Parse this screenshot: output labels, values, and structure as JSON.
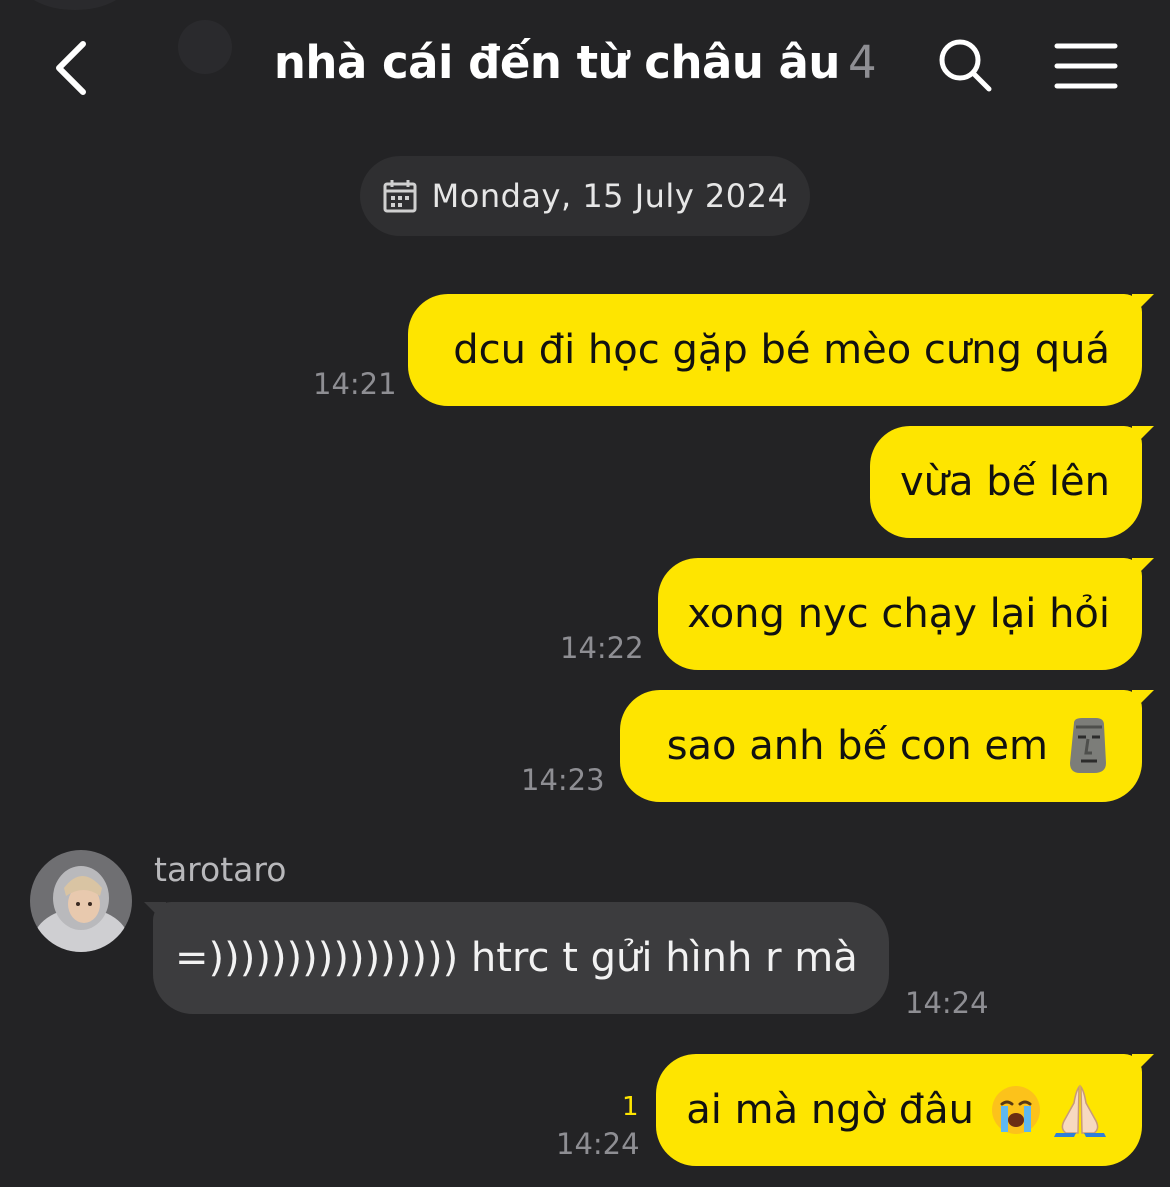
{
  "header": {
    "title": "nhà cái đến từ châu âu",
    "member_count": "4"
  },
  "date_separator": {
    "label": "Monday, 15 July 2024"
  },
  "messages": [
    {
      "direction": "out",
      "text": "dcu đi học gặp bé mèo cưng quá",
      "time": "14:21"
    },
    {
      "direction": "out",
      "text": "vừa bế lên",
      "time": ""
    },
    {
      "direction": "out",
      "text": "xong nyc chạy lại hỏi",
      "time": "14:22"
    },
    {
      "direction": "out",
      "text": "sao anh bế con em",
      "emoji": "moai-emoji",
      "time": "14:23"
    },
    {
      "direction": "in",
      "sender": "tarotaro",
      "text": "=)))))))))))))))) htrc t gửi hình r mà",
      "time": "14:24"
    },
    {
      "direction": "out",
      "text": "ai mà ngờ đâu",
      "emoji": [
        "loudly-crying-face-emoji",
        "folded-hands-emoji"
      ],
      "time": "14:24",
      "unread_count": "1"
    }
  ],
  "colors": {
    "background": "#232325",
    "outgoing_bubble": "#fee500",
    "incoming_bubble": "#3c3c3e",
    "date_pill": "#2f2f31",
    "timestamp": "#8e8e93",
    "unread_badge": "#fee500"
  },
  "icons": [
    "chevron-left-icon",
    "search-icon",
    "hamburger-menu-icon",
    "calendar-icon"
  ]
}
